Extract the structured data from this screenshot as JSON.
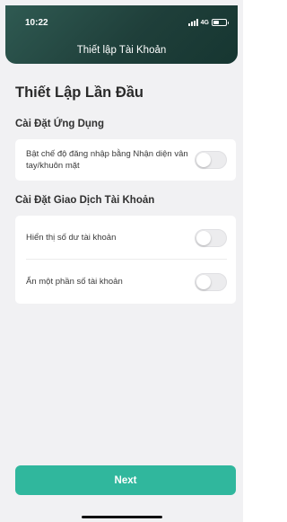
{
  "status_bar": {
    "time": "10:22",
    "network": "4G"
  },
  "header": {
    "title": "Thiết lập Tài Khoản"
  },
  "page": {
    "title": "Thiết Lập Lần Đầu"
  },
  "sections": [
    {
      "title": "Cài Đặt Ứng Dụng",
      "items": [
        {
          "label": "Bật chế độ đăng nhập bằng Nhận diện vân tay/khuôn mặt",
          "enabled": false
        }
      ]
    },
    {
      "title": "Cài Đặt Giao Dịch Tài Khoản",
      "items": [
        {
          "label": "Hiển thị số dư tài khoản",
          "enabled": false
        },
        {
          "label": "Ẩn một phần số tài khoản",
          "enabled": false
        }
      ]
    }
  ],
  "footer": {
    "next_label": "Next"
  },
  "colors": {
    "header_bg": "#1f3f3a",
    "primary_button": "#30b79d",
    "background": "#f1f1f3",
    "toggle_off": "#ececee"
  }
}
